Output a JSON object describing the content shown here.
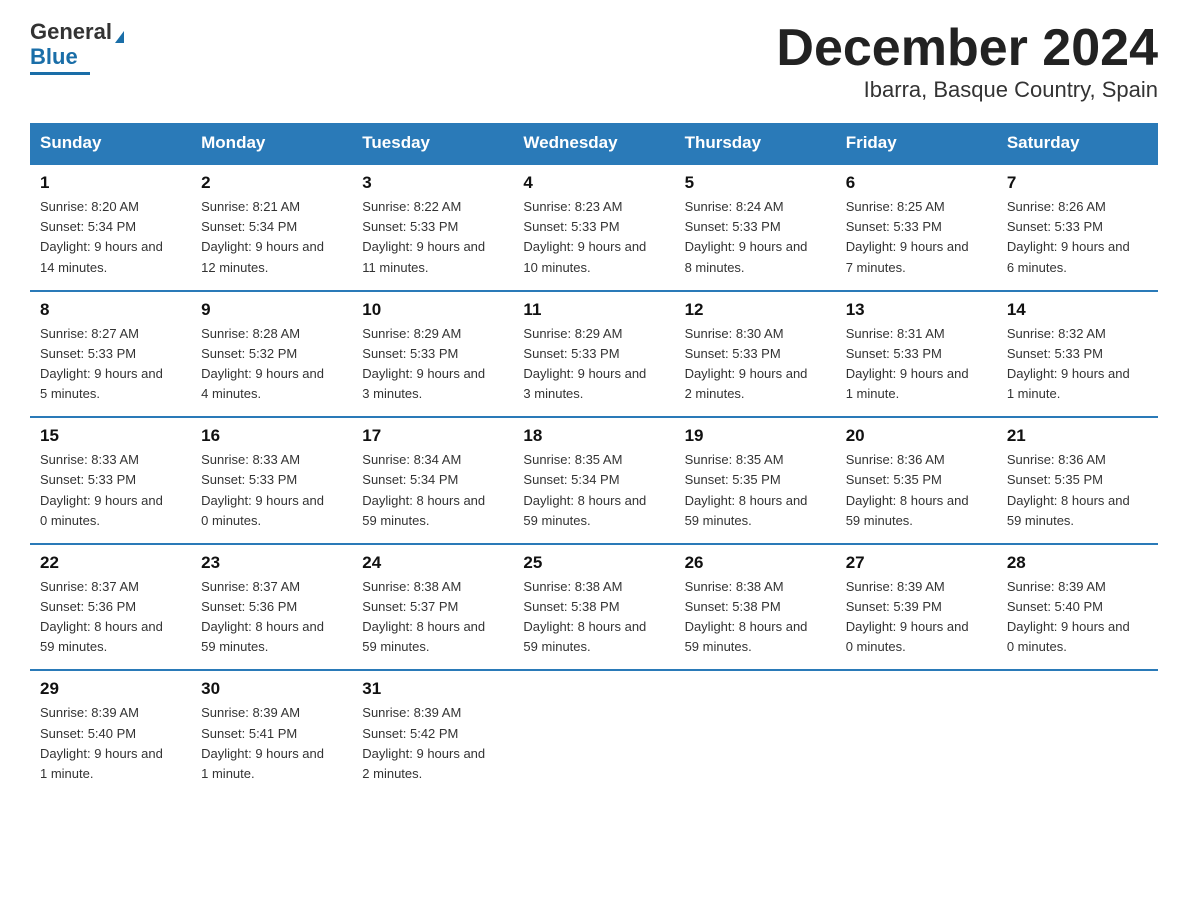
{
  "header": {
    "logo_line1": "General",
    "logo_line2": "Blue",
    "title": "December 2024",
    "subtitle": "Ibarra, Basque Country, Spain"
  },
  "days_of_week": [
    "Sunday",
    "Monday",
    "Tuesday",
    "Wednesday",
    "Thursday",
    "Friday",
    "Saturday"
  ],
  "weeks": [
    [
      {
        "day": "1",
        "sunrise": "8:20 AM",
        "sunset": "5:34 PM",
        "daylight": "9 hours and 14 minutes."
      },
      {
        "day": "2",
        "sunrise": "8:21 AM",
        "sunset": "5:34 PM",
        "daylight": "9 hours and 12 minutes."
      },
      {
        "day": "3",
        "sunrise": "8:22 AM",
        "sunset": "5:33 PM",
        "daylight": "9 hours and 11 minutes."
      },
      {
        "day": "4",
        "sunrise": "8:23 AM",
        "sunset": "5:33 PM",
        "daylight": "9 hours and 10 minutes."
      },
      {
        "day": "5",
        "sunrise": "8:24 AM",
        "sunset": "5:33 PM",
        "daylight": "9 hours and 8 minutes."
      },
      {
        "day": "6",
        "sunrise": "8:25 AM",
        "sunset": "5:33 PM",
        "daylight": "9 hours and 7 minutes."
      },
      {
        "day": "7",
        "sunrise": "8:26 AM",
        "sunset": "5:33 PM",
        "daylight": "9 hours and 6 minutes."
      }
    ],
    [
      {
        "day": "8",
        "sunrise": "8:27 AM",
        "sunset": "5:33 PM",
        "daylight": "9 hours and 5 minutes."
      },
      {
        "day": "9",
        "sunrise": "8:28 AM",
        "sunset": "5:32 PM",
        "daylight": "9 hours and 4 minutes."
      },
      {
        "day": "10",
        "sunrise": "8:29 AM",
        "sunset": "5:33 PM",
        "daylight": "9 hours and 3 minutes."
      },
      {
        "day": "11",
        "sunrise": "8:29 AM",
        "sunset": "5:33 PM",
        "daylight": "9 hours and 3 minutes."
      },
      {
        "day": "12",
        "sunrise": "8:30 AM",
        "sunset": "5:33 PM",
        "daylight": "9 hours and 2 minutes."
      },
      {
        "day": "13",
        "sunrise": "8:31 AM",
        "sunset": "5:33 PM",
        "daylight": "9 hours and 1 minute."
      },
      {
        "day": "14",
        "sunrise": "8:32 AM",
        "sunset": "5:33 PM",
        "daylight": "9 hours and 1 minute."
      }
    ],
    [
      {
        "day": "15",
        "sunrise": "8:33 AM",
        "sunset": "5:33 PM",
        "daylight": "9 hours and 0 minutes."
      },
      {
        "day": "16",
        "sunrise": "8:33 AM",
        "sunset": "5:33 PM",
        "daylight": "9 hours and 0 minutes."
      },
      {
        "day": "17",
        "sunrise": "8:34 AM",
        "sunset": "5:34 PM",
        "daylight": "8 hours and 59 minutes."
      },
      {
        "day": "18",
        "sunrise": "8:35 AM",
        "sunset": "5:34 PM",
        "daylight": "8 hours and 59 minutes."
      },
      {
        "day": "19",
        "sunrise": "8:35 AM",
        "sunset": "5:35 PM",
        "daylight": "8 hours and 59 minutes."
      },
      {
        "day": "20",
        "sunrise": "8:36 AM",
        "sunset": "5:35 PM",
        "daylight": "8 hours and 59 minutes."
      },
      {
        "day": "21",
        "sunrise": "8:36 AM",
        "sunset": "5:35 PM",
        "daylight": "8 hours and 59 minutes."
      }
    ],
    [
      {
        "day": "22",
        "sunrise": "8:37 AM",
        "sunset": "5:36 PM",
        "daylight": "8 hours and 59 minutes."
      },
      {
        "day": "23",
        "sunrise": "8:37 AM",
        "sunset": "5:36 PM",
        "daylight": "8 hours and 59 minutes."
      },
      {
        "day": "24",
        "sunrise": "8:38 AM",
        "sunset": "5:37 PM",
        "daylight": "8 hours and 59 minutes."
      },
      {
        "day": "25",
        "sunrise": "8:38 AM",
        "sunset": "5:38 PM",
        "daylight": "8 hours and 59 minutes."
      },
      {
        "day": "26",
        "sunrise": "8:38 AM",
        "sunset": "5:38 PM",
        "daylight": "8 hours and 59 minutes."
      },
      {
        "day": "27",
        "sunrise": "8:39 AM",
        "sunset": "5:39 PM",
        "daylight": "9 hours and 0 minutes."
      },
      {
        "day": "28",
        "sunrise": "8:39 AM",
        "sunset": "5:40 PM",
        "daylight": "9 hours and 0 minutes."
      }
    ],
    [
      {
        "day": "29",
        "sunrise": "8:39 AM",
        "sunset": "5:40 PM",
        "daylight": "9 hours and 1 minute."
      },
      {
        "day": "30",
        "sunrise": "8:39 AM",
        "sunset": "5:41 PM",
        "daylight": "9 hours and 1 minute."
      },
      {
        "day": "31",
        "sunrise": "8:39 AM",
        "sunset": "5:42 PM",
        "daylight": "9 hours and 2 minutes."
      },
      {
        "day": "",
        "sunrise": "",
        "sunset": "",
        "daylight": ""
      },
      {
        "day": "",
        "sunrise": "",
        "sunset": "",
        "daylight": ""
      },
      {
        "day": "",
        "sunrise": "",
        "sunset": "",
        "daylight": ""
      },
      {
        "day": "",
        "sunrise": "",
        "sunset": "",
        "daylight": ""
      }
    ]
  ],
  "labels": {
    "sunrise": "Sunrise:",
    "sunset": "Sunset:",
    "daylight": "Daylight:"
  }
}
